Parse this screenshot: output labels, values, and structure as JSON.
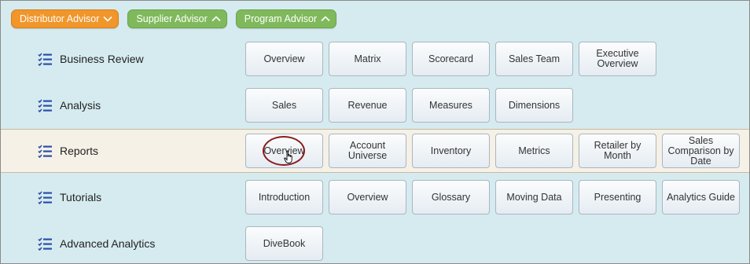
{
  "advisors": [
    {
      "label": "Distributor Advisor",
      "color": "#f0962b",
      "chevron": "chevron-down-icon"
    },
    {
      "label": "Supplier Advisor",
      "color": "#7fb95c",
      "chevron": "chevron-up-icon"
    },
    {
      "label": "Program Advisor",
      "color": "#7fb95c",
      "chevron": "chevron-up-icon"
    }
  ],
  "sections": [
    {
      "title": "Business Review",
      "items": [
        "Overview",
        "Matrix",
        "Scorecard",
        "Sales Team",
        "Executive Overview"
      ]
    },
    {
      "title": "Analysis",
      "items": [
        "Sales",
        "Revenue",
        "Measures",
        "Dimensions"
      ]
    },
    {
      "title": "Reports",
      "active": true,
      "selected_item": "Overview",
      "items": [
        "Overview",
        "Account Universe",
        "Inventory",
        "Metrics",
        "Retailer by Month",
        "Sales Comparison by Date"
      ]
    },
    {
      "title": "Tutorials",
      "items": [
        "Introduction",
        "Overview",
        "Glossary",
        "Moving Data",
        "Presenting",
        "Analytics Guide"
      ]
    },
    {
      "title": "Advanced Analytics",
      "items": [
        "DiveBook"
      ]
    }
  ],
  "colors": {
    "background": "#d6ebf0",
    "active_row": "#f6f1e6",
    "selection_ring": "#8b1a1a",
    "list_icon": "#2a4fa8"
  }
}
